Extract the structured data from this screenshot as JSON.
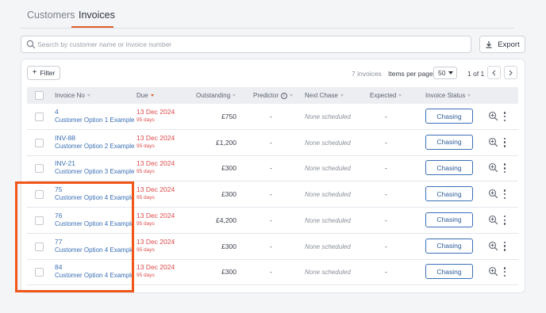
{
  "tabs": [
    {
      "label": "Customers",
      "active": false
    },
    {
      "label": "Invoices",
      "active": true
    }
  ],
  "search": {
    "placeholder": "Search by customer name or invoice number"
  },
  "export_label": "Export",
  "toolbar": {
    "filter_label": "Filter",
    "invoice_count": "7 invoices",
    "items_per_page_label": "Items per page:",
    "items_per_page_value": "50",
    "page_info": "1 of 1"
  },
  "columns": {
    "invoice_no": "Invoice No",
    "due": "Due",
    "outstanding": "Outstanding",
    "predictor": "Predictor",
    "next_chase": "Next Chase",
    "expected": "Expected",
    "invoice_status": "Invoice Status"
  },
  "rows": [
    {
      "invoice": "4",
      "customer": "Customer Option 1 Example",
      "due": "13 Dec 2024",
      "days": "95 days",
      "outstanding": "£750",
      "predictor": "-",
      "next_chase": "None scheduled",
      "expected": "-",
      "status": "Chasing"
    },
    {
      "invoice": "INV-88",
      "customer": "Customer Option 2 Example",
      "due": "13 Dec 2024",
      "days": "95 days",
      "outstanding": "£1,200",
      "predictor": "-",
      "next_chase": "None scheduled",
      "expected": "-",
      "status": "Chasing"
    },
    {
      "invoice": "INV-21",
      "customer": "Customer Option 3 Example",
      "due": "13 Dec 2024",
      "days": "95 days",
      "outstanding": "£300",
      "predictor": "-",
      "next_chase": "None scheduled",
      "expected": "-",
      "status": "Chasing"
    },
    {
      "invoice": "75",
      "customer": "Customer Option 4 Example",
      "due": "13 Dec 2024",
      "days": "95 days",
      "outstanding": "£300",
      "predictor": "-",
      "next_chase": "None scheduled",
      "expected": "-",
      "status": "Chasing"
    },
    {
      "invoice": "76",
      "customer": "Customer Option 4 Example",
      "due": "13 Dec 2024",
      "days": "95 days",
      "outstanding": "£4,200",
      "predictor": "-",
      "next_chase": "None scheduled",
      "expected": "-",
      "status": "Chasing"
    },
    {
      "invoice": "77",
      "customer": "Customer Option 4 Example",
      "due": "13 Dec 2024",
      "days": "95 days",
      "outstanding": "£300",
      "predictor": "-",
      "next_chase": "None scheduled",
      "expected": "-",
      "status": "Chasing"
    },
    {
      "invoice": "84",
      "customer": "Customer Option 4 Example",
      "due": "13 Dec 2024",
      "days": "95 days",
      "outstanding": "£300",
      "predictor": "-",
      "next_chase": "None scheduled",
      "expected": "-",
      "status": "Chasing"
    }
  ],
  "colors": {
    "accent": "#e2602a",
    "link": "#3a6fb6",
    "overdue": "#e04a4a",
    "highlight": "#f0561a"
  },
  "icons": [
    "search-icon",
    "download-icon",
    "plus-icon",
    "chevron-left-icon",
    "chevron-right-icon",
    "info-icon",
    "zoom-in-icon",
    "more-vertical-icon"
  ]
}
